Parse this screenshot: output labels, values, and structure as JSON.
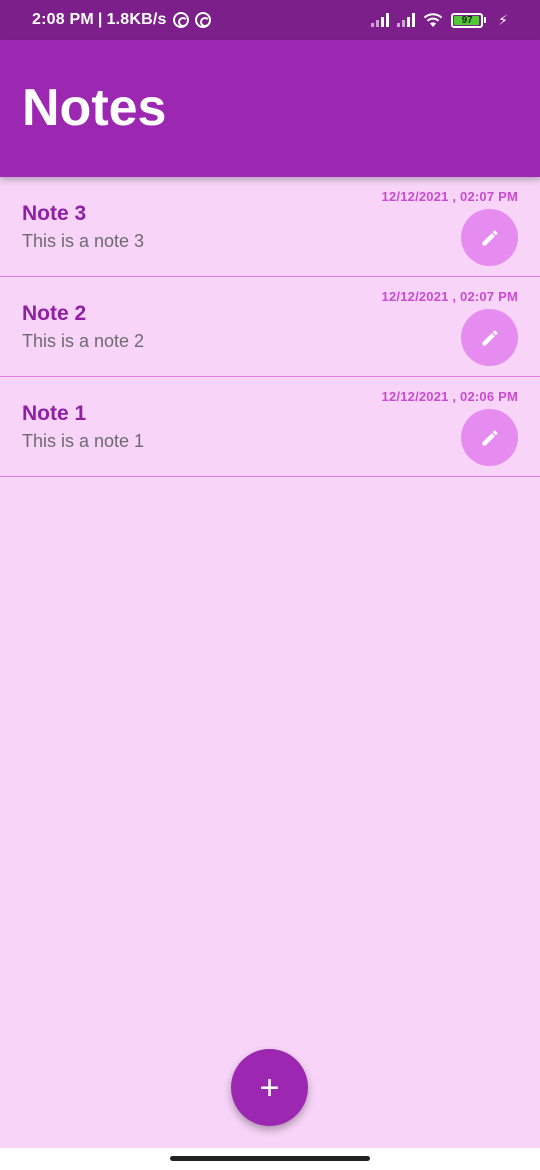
{
  "status_bar": {
    "time": "2:08 PM",
    "separator": "|",
    "speed": "1.8KB/s",
    "battery_level": "97",
    "battery_fraction": 0.97,
    "icons": [
      "circle-notification-icon",
      "circle-notification-icon",
      "signal-icon",
      "signal-icon",
      "wifi-icon",
      "battery-icon",
      "charging-icon"
    ]
  },
  "app_bar": {
    "title": "Notes"
  },
  "notes": [
    {
      "title": "Note 3",
      "body": "This is a note 3",
      "date": "12/12/2021 ,  02:07 PM",
      "action_icon": "pencil-icon"
    },
    {
      "title": "Note 2",
      "body": "This is a note 2",
      "date": "12/12/2021 ,  02:07 PM",
      "action_icon": "pencil-icon"
    },
    {
      "title": "Note 1",
      "body": "This is a note 1",
      "date": "12/12/2021 ,  02:06 PM",
      "action_icon": "pencil-icon"
    }
  ],
  "fab": {
    "label": "+",
    "icon": "plus-icon"
  },
  "colors": {
    "status_bar": "#7c1f8a",
    "primary": "#9c27b0",
    "background": "#f7d4f8",
    "note_title": "#8f1fa3",
    "date": "#c94bd0",
    "edit_button": "#e68bef",
    "divider": "#e07de3"
  }
}
